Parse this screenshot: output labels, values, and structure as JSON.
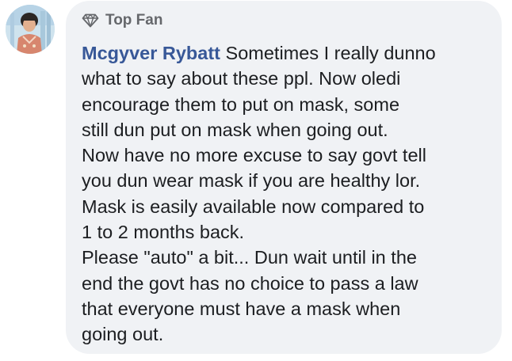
{
  "comment": {
    "badge_label": "Top Fan",
    "badge_icon": "diamond-icon",
    "author_name": "Mcgyver Rybatt",
    "text": "Sometimes I really dunno\nwhat to say about these ppl. Now oledi\nencourage them to put on mask, some\nstill dun put on mask when going out.\nNow have no more excuse to say govt tell\nyou dun wear mask if you are healthy lor.\nMask is easily available now compared to\n1 to 2 months back.\nPlease \"auto\" a bit... Dun wait until in the\nend the govt has no choice to pass a law\nthat everyone must have a mask when\ngoing out.",
    "colors": {
      "bubble_background": "#f0f2f5",
      "author_link": "#385898",
      "badge_text": "#65676b",
      "body_text": "#1c1e21"
    }
  }
}
